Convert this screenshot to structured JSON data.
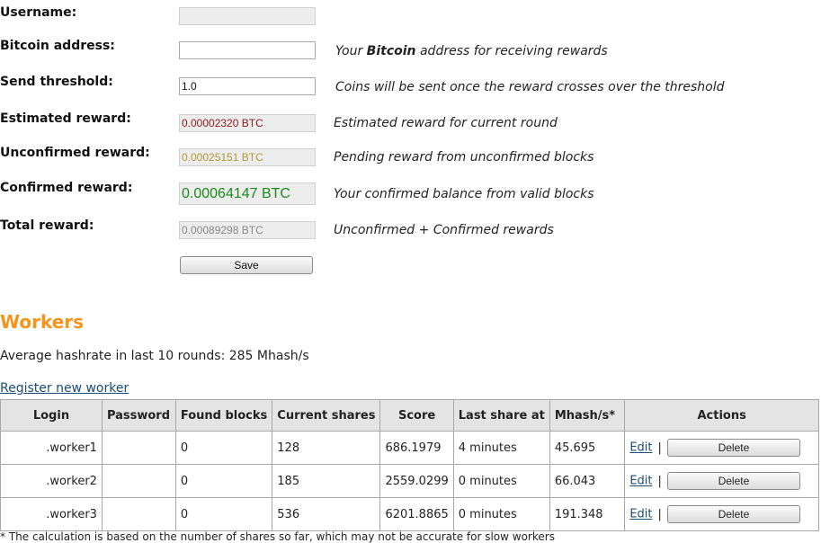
{
  "form": {
    "username": {
      "label": "Username:",
      "value": ""
    },
    "bitcoin_address": {
      "label": "Bitcoin address:",
      "value": "",
      "hint_pre": "Your ",
      "hint_bold": "Bitcoin",
      "hint_post": " address for receiving rewards"
    },
    "send_threshold": {
      "label": "Send threshold:",
      "value": "1.0",
      "hint": "Coins will be sent once the reward crosses over the threshold"
    },
    "estimated_reward": {
      "label": "Estimated reward:",
      "value": "0.00002320 BTC",
      "hint": "Estimated reward for current round",
      "color": "#8b1a1a"
    },
    "unconfirmed_reward": {
      "label": "Unconfirmed reward:",
      "value": "0.00025151 BTC",
      "hint": "Pending reward from unconfirmed blocks",
      "color": "#b09a3a"
    },
    "confirmed_reward": {
      "label": "Confirmed reward:",
      "value": "0.00064147 BTC",
      "hint": "Your confirmed balance from valid blocks",
      "color": "#1a8a1a"
    },
    "total_reward": {
      "label": "Total reward:",
      "value": "0.00089298 BTC",
      "hint": "Unconfirmed + Confirmed rewards",
      "color": "#888888"
    },
    "save_label": "Save"
  },
  "workers": {
    "title": "Workers",
    "avg_hashrate": "Average hashrate in last 10 rounds: 285 Mhash/s",
    "register_link": "Register new worker",
    "columns": [
      "Login",
      "Password",
      "Found blocks",
      "Current shares",
      "Score",
      "Last share at",
      "Mhash/s*",
      "Actions"
    ],
    "rows": [
      {
        "login": ".worker1",
        "password": "",
        "found_blocks": "0",
        "current_shares": "128",
        "score": "686.1979",
        "last_share": "4 minutes",
        "mhash": "45.695",
        "edit": "Edit",
        "sep": "|",
        "delete": "Delete"
      },
      {
        "login": ".worker2",
        "password": "",
        "found_blocks": "0",
        "current_shares": "185",
        "score": "2559.0299",
        "last_share": "0 minutes",
        "mhash": "66.043",
        "edit": "Edit",
        "sep": "|",
        "delete": "Delete"
      },
      {
        "login": ".worker3",
        "password": "",
        "found_blocks": "0",
        "current_shares": "536",
        "score": "6201.8865",
        "last_share": "0 minutes",
        "mhash": "191.348",
        "edit": "Edit",
        "sep": "|",
        "delete": "Delete"
      }
    ],
    "footnote": "* The calculation is based on the number of shares so far, which may not be accurate for slow workers"
  }
}
